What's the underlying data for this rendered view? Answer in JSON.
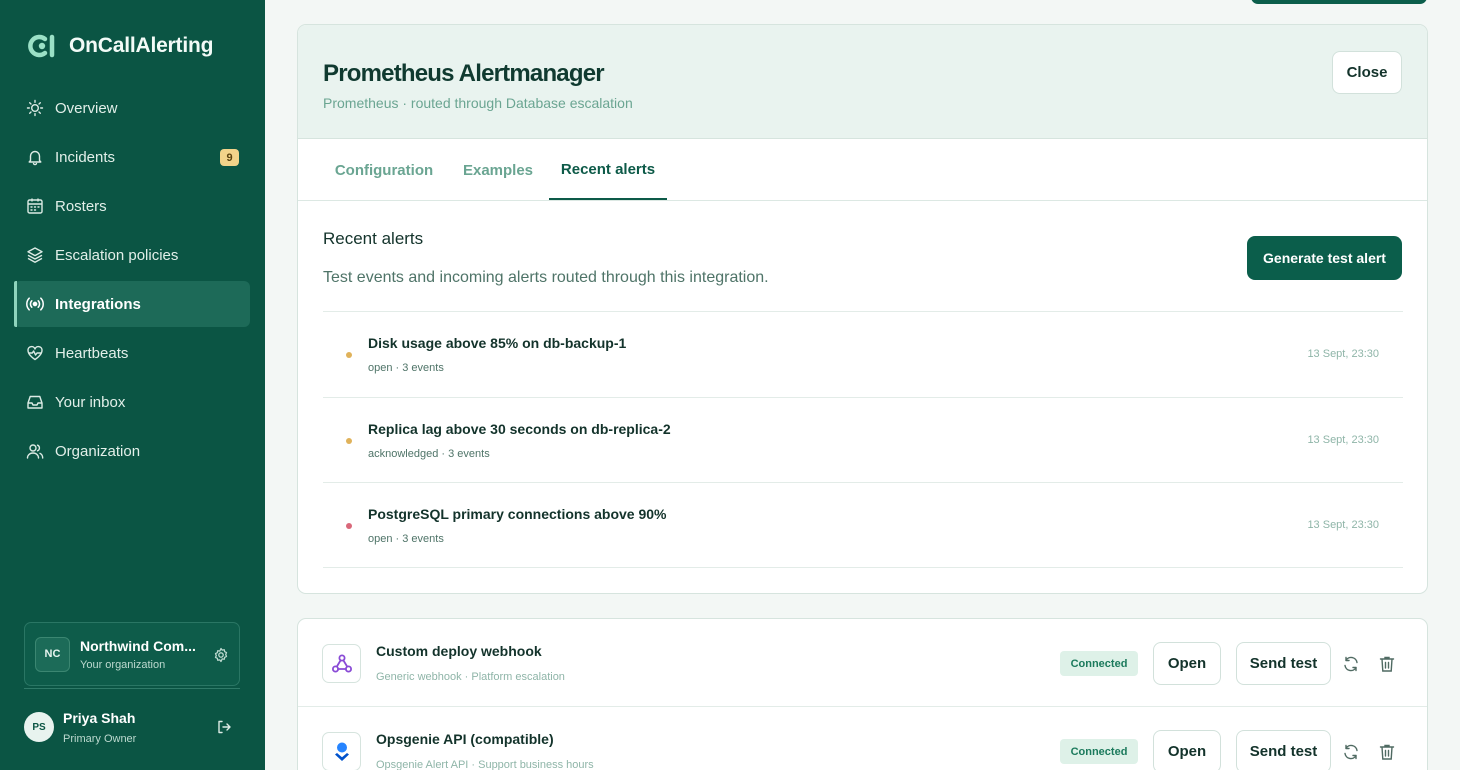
{
  "app": {
    "name": "OnCallAlerting"
  },
  "nav": [
    {
      "label": "Overview",
      "icon": "sun-icon"
    },
    {
      "label": "Incidents",
      "icon": "bell-icon",
      "badge": "9"
    },
    {
      "label": "Rosters",
      "icon": "calendar-icon"
    },
    {
      "label": "Escalation policies",
      "icon": "layers-icon"
    },
    {
      "label": "Integrations",
      "icon": "broadcast-icon",
      "active": true
    },
    {
      "label": "Heartbeats",
      "icon": "heart-pulse-icon"
    },
    {
      "label": "Your inbox",
      "icon": "inbox-icon"
    },
    {
      "label": "Organization",
      "icon": "users-icon"
    }
  ],
  "org": {
    "initials": "NC",
    "name": "Northwind Com...",
    "subtitle": "Your organization"
  },
  "user": {
    "initials": "PS",
    "name": "Priya Shah",
    "role": "Primary Owner"
  },
  "panel": {
    "title": "Prometheus Alertmanager",
    "subtitle": "Prometheus · routed through Database escalation",
    "close_label": "Close",
    "tabs": [
      "Configuration",
      "Examples",
      "Recent alerts"
    ],
    "active_tab": "Recent alerts",
    "section_title": "Recent alerts",
    "section_desc": "Test events and incoming alerts routed through this integration.",
    "generate_label": "Generate test alert",
    "alerts": [
      {
        "title": "Disk usage above 85% on db-backup-1",
        "meta": "open · 3 events",
        "time": "13 Sept, 23:30",
        "color": "#e0b25a"
      },
      {
        "title": "Replica lag above 30 seconds on db-replica-2",
        "meta": "acknowledged · 3 events",
        "time": "13 Sept, 23:30",
        "color": "#e0b25a"
      },
      {
        "title": "PostgreSQL primary connections above 90%",
        "meta": "open · 3 events",
        "time": "13 Sept, 23:30",
        "color": "#d9687a"
      }
    ]
  },
  "integrations": [
    {
      "name": "Custom deploy webhook",
      "subtitle": "Generic webhook · Platform escalation",
      "status": "Connected",
      "open_label": "Open",
      "send_label": "Send test",
      "icon": "webhook-icon"
    },
    {
      "name": "Opsgenie API (compatible)",
      "subtitle": "Opsgenie Alert API · Support business hours",
      "status": "Connected",
      "open_label": "Open",
      "send_label": "Send test",
      "icon": "opsgenie-icon"
    }
  ],
  "colors": {
    "sidebar": "#0b5544",
    "accent": "#0b5e4b",
    "badge": "#f2d38a"
  }
}
